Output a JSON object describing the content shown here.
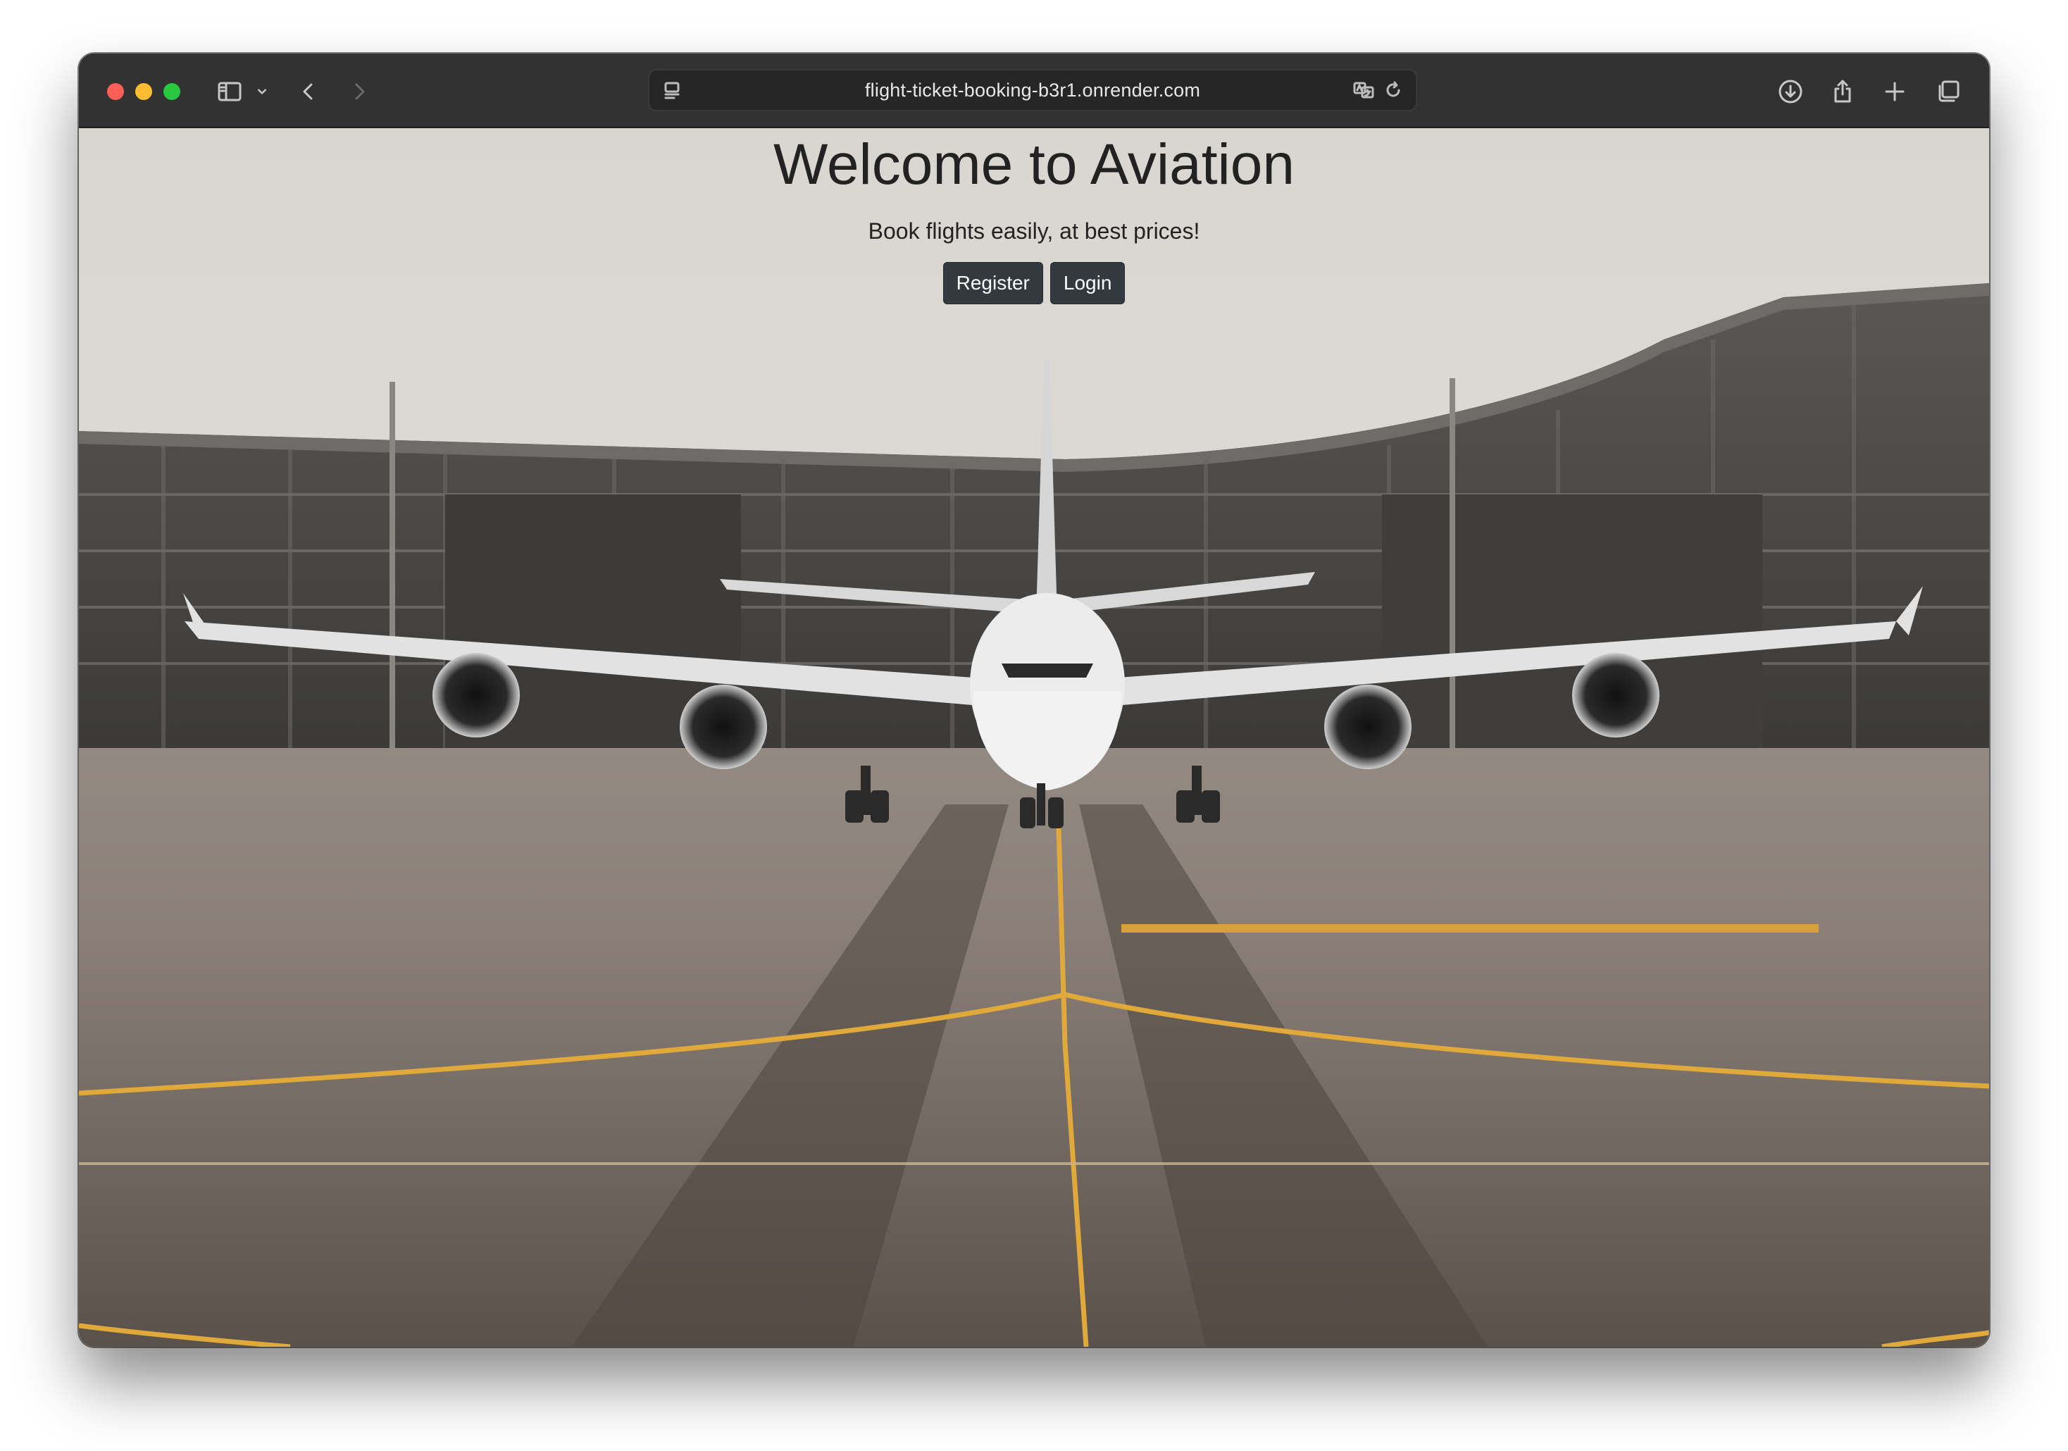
{
  "browser": {
    "url": "flight-ticket-booking-b3r1.onrender.com",
    "icons": [
      "sidebar-icon",
      "chevron-down-icon",
      "back-arrow-icon",
      "forward-arrow-icon",
      "page-menu-icon",
      "translate-icon",
      "reload-icon",
      "download-icon",
      "share-icon",
      "new-tab-plus-icon",
      "tab-overview-icon"
    ]
  },
  "hero": {
    "title": "Welcome to Aviation",
    "subtitle": "Book flights easily, at best prices!",
    "register_label": "Register",
    "login_label": "Login"
  },
  "colors": {
    "button_bg": "#323a40",
    "heading_text": "#222222",
    "toolbar_bg": "#323232"
  }
}
